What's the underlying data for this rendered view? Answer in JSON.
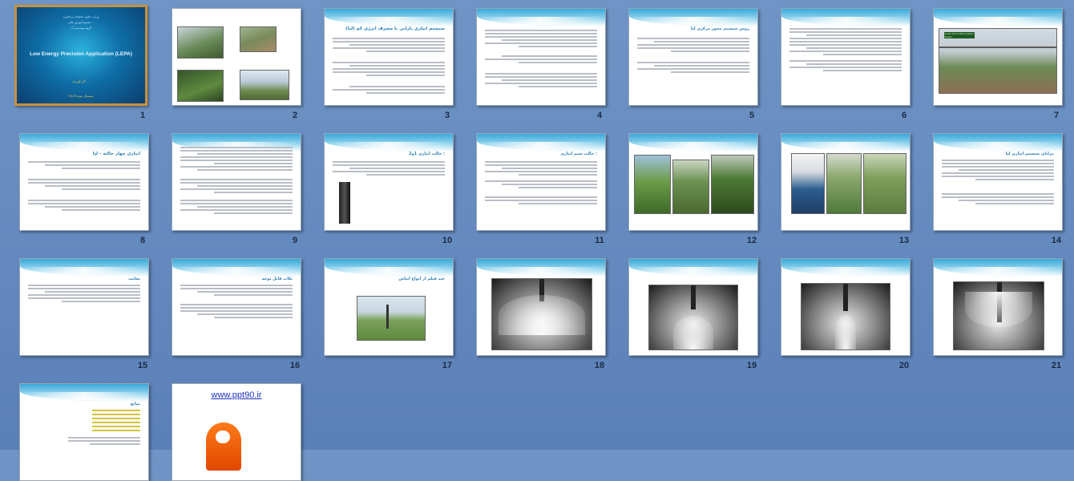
{
  "slides": [
    {
      "number": "1",
      "type": "cover",
      "selected": true
    },
    {
      "number": "2",
      "type": "photo-grid"
    },
    {
      "number": "3",
      "type": "text",
      "title": "سیستم آبیاری بارانی با مصرف انرژی کم (لپا)"
    },
    {
      "number": "4",
      "type": "text",
      "title": ""
    },
    {
      "number": "5",
      "type": "text",
      "title": "روش سیستم محور مرکزی لپا"
    },
    {
      "number": "6",
      "type": "text",
      "title": ""
    },
    {
      "number": "7",
      "type": "photo-text",
      "title": ""
    },
    {
      "number": "8",
      "type": "text",
      "title": "آبیاری چهار حالته - لپا"
    },
    {
      "number": "9",
      "type": "text",
      "title": ""
    },
    {
      "number": "10",
      "type": "photo-text",
      "title": "حالت آبیاری 1و2 :"
    },
    {
      "number": "11",
      "type": "text",
      "title": "حالت شیم آبیاری :"
    },
    {
      "number": "12",
      "type": "photo-grid"
    },
    {
      "number": "13",
      "type": "photo-grid"
    },
    {
      "number": "14",
      "type": "text",
      "title": "مزایای سیستم آبیاری لپا"
    },
    {
      "number": "15",
      "type": "text",
      "title": "معایب"
    },
    {
      "number": "16",
      "type": "text",
      "title": "نکات قابل توجه"
    },
    {
      "number": "17",
      "type": "photo-text",
      "title": "چند فیلم از انواع آبپاش"
    },
    {
      "number": "18",
      "type": "spray"
    },
    {
      "number": "19",
      "type": "spray"
    },
    {
      "number": "20",
      "type": "spray"
    },
    {
      "number": "21",
      "type": "spray"
    },
    {
      "number": "22",
      "type": "sources",
      "title": "منابع"
    },
    {
      "number": "23",
      "type": "end"
    }
  ],
  "cover": {
    "line1": "وزارت علوم، تحقیقات و فناوری",
    "line2": "مجتمع آموزش عالی ...",
    "line3": "گروه مهندسی آب",
    "title": "Low Energy Precision Application (LEPA)",
    "authors": "گردآورنده: ...",
    "term": "نیمسال دوم 93-92"
  },
  "slide7_banner": "Center Pivot LEPA Irrigation System",
  "end_slide": {
    "url": "www.ppt90.ir"
  },
  "colors": {
    "background": "#6f95c6",
    "accent": "#2a7fb4",
    "selected_border": "#c8913b"
  }
}
